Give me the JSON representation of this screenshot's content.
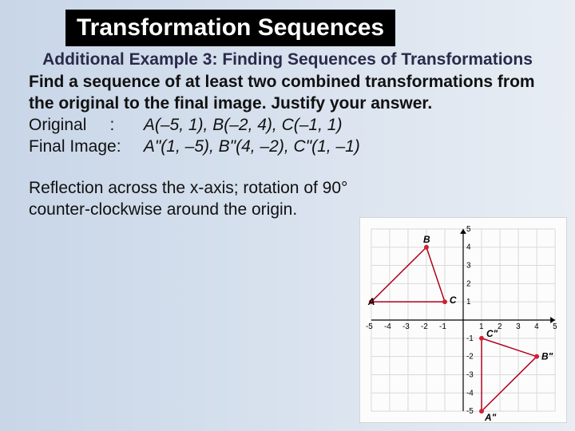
{
  "title": "Transformation Sequences",
  "subtitle": "Additional Example 3: Finding Sequences of Transformations",
  "problem": "Find a sequence of at least two combined transformations from the original to the final image. Justify your answer.",
  "orig_label": "Original",
  "final_label": "Final Image:",
  "orig_coords": "A(–5, 1),   B(–2, 4),   C(–1, 1)",
  "final_coords": "A\"(1, –5),   B\"(4, –2), C\"(1, –1)",
  "answer": "Reflection across the x-axis; rotation of 90° counter-clockwise around the origin.",
  "chart_data": {
    "type": "scatter",
    "title": "",
    "xlabel": "",
    "ylabel": "",
    "xlim": [
      -5,
      5
    ],
    "ylim": [
      -5,
      5
    ],
    "grid": true,
    "series": [
      {
        "name": "Original",
        "points": [
          {
            "label": "A",
            "x": -5,
            "y": 1
          },
          {
            "label": "B",
            "x": -2,
            "y": 4
          },
          {
            "label": "C",
            "x": -1,
            "y": 1
          }
        ]
      },
      {
        "name": "Final",
        "points": [
          {
            "label": "A\"",
            "x": 1,
            "y": -5
          },
          {
            "label": "B\"",
            "x": 4,
            "y": -2
          },
          {
            "label": "C\"",
            "x": 1,
            "y": -1
          }
        ]
      }
    ],
    "ticks_x": [
      -5,
      -4,
      -3,
      -2,
      -1,
      1,
      2,
      3,
      4,
      5
    ],
    "ticks_y": [
      -5,
      -4,
      -3,
      -2,
      -1,
      1,
      2,
      3,
      4,
      5
    ]
  }
}
